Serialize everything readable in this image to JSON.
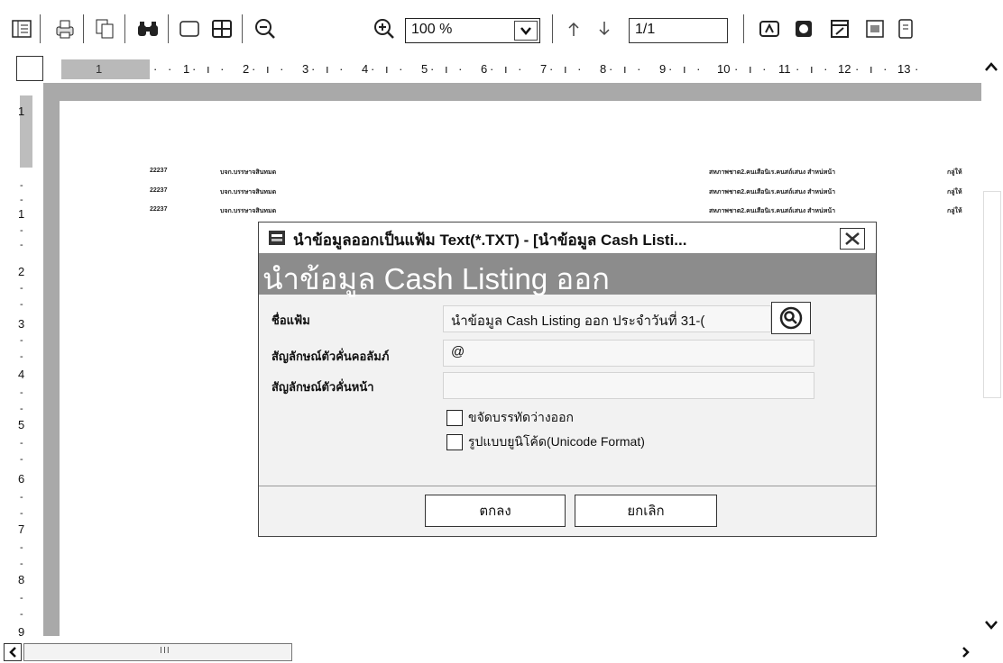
{
  "toolbar": {
    "zoom_value": "100 %",
    "page_value": "1/1",
    "icons": [
      "sidebar-icon",
      "printer-icon",
      "copy-icon",
      "find-icon",
      "single-page-icon",
      "multi-page-icon",
      "zoom-out-icon",
      "zoom-in-icon",
      "previous-page-icon",
      "next-page-icon",
      "export-icon",
      "export-2-icon",
      "export-3-icon",
      "export-4-icon",
      "export-5-icon"
    ]
  },
  "ruler": {
    "marker": "1",
    "h_numbers": [
      "1",
      "2",
      "3",
      "4",
      "5",
      "6",
      "7",
      "8",
      "9",
      "10",
      "11",
      "12",
      "13"
    ],
    "v_numbers": [
      "1",
      "1",
      "2",
      "3",
      "4",
      "5",
      "6",
      "7",
      "8",
      "9"
    ]
  },
  "document": {
    "rows": [
      {
        "col1": "22237",
        "col2": "บจก.บรรษาจสินทมด",
        "col3": "สหภาพชาต2.คนเสือนิเร.คนสถ์เสนง สำหน่หน้า",
        "col4": "กลู่ให้"
      },
      {
        "col1": "22237",
        "col2": "บจก.บรรษาจสินทมด",
        "col3": "สหภาพชาต2.คนเสือนิเร.คนสถ์เสนง สำหน่หน้า",
        "col4": "กลู่ให้"
      },
      {
        "col1": "22237",
        "col2": "บจก.บรรษาจสินทมด",
        "col3": "สหภาพชาต2.คนเสือนิเร.คนสถ์เสนง สำหน่หน้า",
        "col4": "กลู่ให้"
      }
    ]
  },
  "dialog": {
    "title": "นำข้อมูลออกเป็นแฟ้ม Text(*.TXT) - [นำข้อมูล Cash Listi...",
    "header": "นำข้อมูล Cash Listing ออก",
    "fields": {
      "filename_label": "ชื่อแฟ้ม",
      "filename_value": "นำข้อมูล Cash Listing ออก ประจำวันที่ 31-(",
      "column_sep_label": "สัญลักษณ์ตัวคั่นคอลัมภ์",
      "column_sep_value": "@",
      "page_sep_label": "สัญลักษณ์ตัวคั่นหน้า",
      "page_sep_value": ""
    },
    "checkboxes": {
      "remove_blank": "ขจัดบรรทัดว่างออก",
      "unicode": "รูปแบบยูนิโค้ด(Unicode Format)"
    },
    "ok_label": "ตกลง",
    "cancel_label": "ยกเลิก"
  }
}
